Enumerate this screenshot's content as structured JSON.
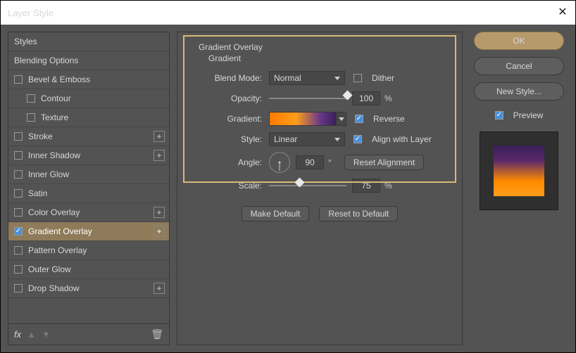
{
  "window": {
    "title": "Layer Style"
  },
  "sidebar": {
    "styles_label": "Styles",
    "blending_label": "Blending Options",
    "items": [
      {
        "label": "Bevel & Emboss"
      },
      {
        "label": "Contour"
      },
      {
        "label": "Texture"
      },
      {
        "label": "Stroke"
      },
      {
        "label": "Inner Shadow"
      },
      {
        "label": "Inner Glow"
      },
      {
        "label": "Satin"
      },
      {
        "label": "Color Overlay"
      },
      {
        "label": "Gradient Overlay"
      },
      {
        "label": "Pattern Overlay"
      },
      {
        "label": "Outer Glow"
      },
      {
        "label": "Drop Shadow"
      }
    ],
    "fx_label": "fx"
  },
  "panel": {
    "section": "Gradient Overlay",
    "subsection": "Gradient",
    "labels": {
      "blend_mode": "Blend Mode:",
      "opacity": "Opacity:",
      "gradient": "Gradient:",
      "style": "Style:",
      "angle": "Angle:",
      "scale": "Scale:"
    },
    "blend_mode_value": "Normal",
    "dither_label": "Dither",
    "opacity_value": "100",
    "opacity_unit": "%",
    "reverse_label": "Reverse",
    "style_value": "Linear",
    "align_label": "Align with Layer",
    "angle_value": "90",
    "angle_unit": "°",
    "reset_alignment": "Reset Alignment",
    "scale_value": "75",
    "scale_unit": "%",
    "make_default": "Make Default",
    "reset_default": "Reset to Default"
  },
  "right": {
    "ok": "OK",
    "cancel": "Cancel",
    "new_style": "New Style...",
    "preview": "Preview"
  }
}
